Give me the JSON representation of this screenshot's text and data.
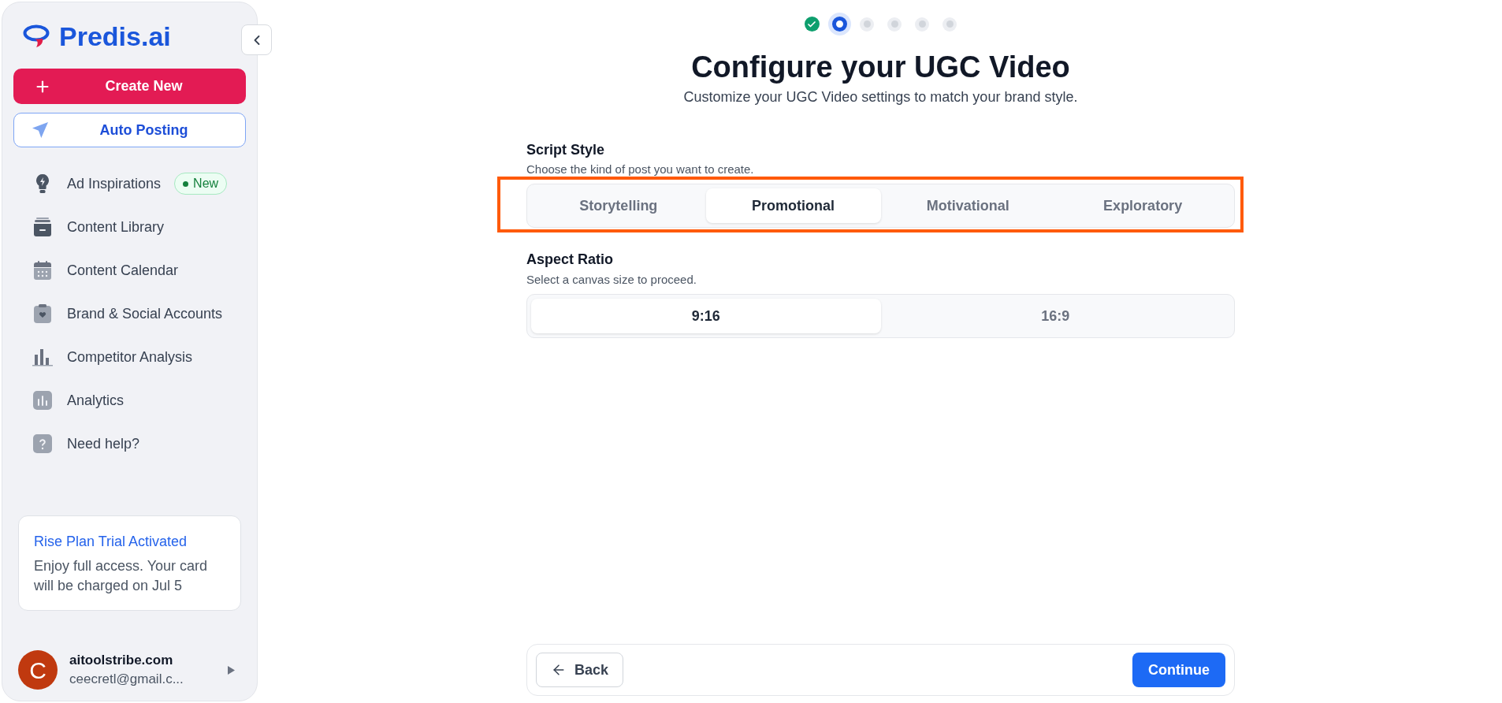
{
  "sidebar": {
    "logo_text": "Predis.ai",
    "create_button": "Create New",
    "auto_posting_button": "Auto Posting",
    "nav_items": [
      {
        "label": "Ad Inspirations",
        "badge": "New"
      },
      {
        "label": "Content Library"
      },
      {
        "label": "Content Calendar"
      },
      {
        "label": "Brand & Social Accounts"
      },
      {
        "label": "Competitor Analysis"
      },
      {
        "label": "Analytics"
      },
      {
        "label": "Need help?"
      }
    ],
    "trial_card": {
      "title": "Rise Plan Trial Activated",
      "body": "Enjoy full access. Your card will be charged on Jul 5"
    },
    "user": {
      "avatar_letter": "C",
      "name": "aitoolstribe.com",
      "email": "ceecretl@gmail.c..."
    }
  },
  "stepper": [
    {
      "completed": true,
      "selected": false
    },
    {
      "completed": false,
      "selected": true
    },
    {
      "completed": false,
      "selected": false
    },
    {
      "completed": false,
      "selected": false
    },
    {
      "completed": false,
      "selected": false
    },
    {
      "completed": false,
      "selected": false
    }
  ],
  "header": {
    "title": "Configure your UGC Video",
    "subtitle": "Customize your UGC Video settings to match your brand style."
  },
  "script_style": {
    "label": "Script Style",
    "description": "Choose the kind of post you want to create.",
    "highlighted": true,
    "options": [
      {
        "label": "Storytelling",
        "selected": false
      },
      {
        "label": "Promotional",
        "selected": true
      },
      {
        "label": "Motivational",
        "selected": false
      },
      {
        "label": "Exploratory",
        "selected": false
      }
    ]
  },
  "aspect_ratio": {
    "label": "Aspect Ratio",
    "description": "Select a canvas size to proceed.",
    "options": [
      {
        "label": "9:16",
        "selected": true
      },
      {
        "label": "16:9",
        "selected": false
      }
    ]
  },
  "footer": {
    "back_button": "Back",
    "continue_button": "Continue"
  }
}
